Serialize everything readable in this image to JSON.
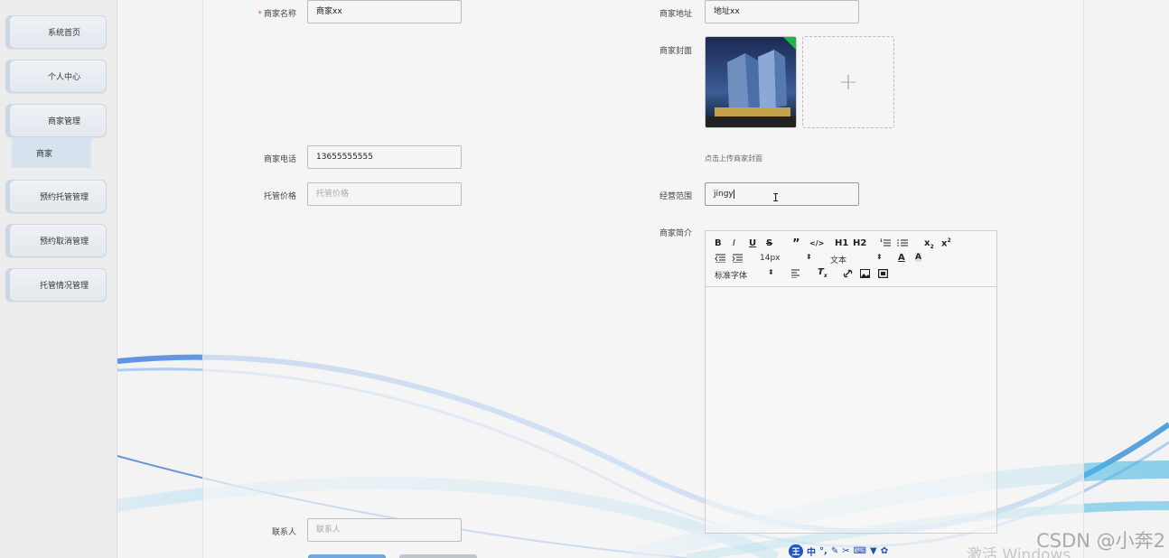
{
  "sidebar": {
    "items": [
      {
        "label": "系统首页"
      },
      {
        "label": "个人中心"
      },
      {
        "label": "商家管理"
      },
      {
        "label": "预约托管管理"
      },
      {
        "label": "预约取消管理"
      },
      {
        "label": "托管情况管理"
      }
    ],
    "submenu_item": "商家"
  },
  "form": {
    "merchant_name": {
      "label": "商家名称",
      "required_mark": "*",
      "value": "商家xx"
    },
    "merchant_address": {
      "label": "商家地址",
      "value": "地址xx"
    },
    "merchant_cover": {
      "label": "商家封面",
      "upload_icon": "plus-icon",
      "hint": "点击上传商家封面"
    },
    "merchant_phone": {
      "label": "商家电话",
      "value": "13655555555"
    },
    "custody_price": {
      "label": "托管价格",
      "placeholder": "托管价格"
    },
    "business_scope": {
      "label": "经营范围",
      "value": "jingy"
    },
    "merchant_intro": {
      "label": "商家简介"
    },
    "contact": {
      "label": "联系人",
      "placeholder": "联系人"
    }
  },
  "editor": {
    "toolbar": {
      "bold": "B",
      "italic": "I",
      "underline": "U",
      "strike": "S",
      "quote": "”",
      "code": "</>",
      "h1": "H1",
      "h2": "H2",
      "font_size": "14px",
      "text_type": "文本",
      "font_family": "标准字体"
    }
  },
  "ime": {
    "badge": "王",
    "mode": "中"
  },
  "watermark": "CSDN @小奔2",
  "activation": "激活 Windows",
  "colors": {
    "accent": "#2055c2",
    "sidebar_active": "#d6e2ee",
    "required": "#e45656"
  }
}
